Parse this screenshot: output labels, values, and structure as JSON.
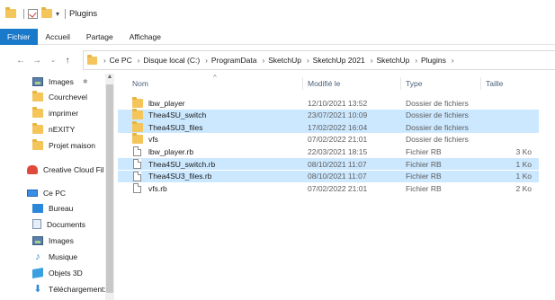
{
  "quick_access": {
    "title": "Plugins"
  },
  "ribbon": {
    "tabs": [
      "Fichier",
      "Accueil",
      "Partage",
      "Affichage"
    ]
  },
  "address": {
    "crumbs": [
      "Ce PC",
      "Disque local (C:)",
      "ProgramData",
      "SketchUp",
      "SketchUp 2021",
      "SketchUp",
      "Plugins"
    ]
  },
  "nav": {
    "items": [
      {
        "label": "Images",
        "icon": "images-icon"
      },
      {
        "label": "Courchevel",
        "icon": "folder-icon"
      },
      {
        "label": "imprimer",
        "icon": "folder-icon"
      },
      {
        "label": "nEXITY",
        "icon": "folder-icon"
      },
      {
        "label": "Projet maison",
        "icon": "folder-icon"
      },
      {
        "label": "Creative Cloud Fil",
        "icon": "creative-cloud-icon"
      },
      {
        "label": "Ce PC",
        "icon": "computer-icon"
      },
      {
        "label": "Bureau",
        "icon": "desktop-icon"
      },
      {
        "label": "Documents",
        "icon": "documents-icon"
      },
      {
        "label": "Images",
        "icon": "images-icon"
      },
      {
        "label": "Musique",
        "icon": "music-icon"
      },
      {
        "label": "Objets 3D",
        "icon": "objects-3d-icon"
      },
      {
        "label": "Téléchargement:",
        "icon": "download-icon"
      }
    ]
  },
  "columns": {
    "name": "Nom",
    "date": "Modifié le",
    "type": "Type",
    "size": "Taille"
  },
  "files": [
    {
      "name": "lbw_player",
      "date": "12/10/2021 13:52",
      "type": "Dossier de fichiers",
      "size": "",
      "kind": "folder",
      "selected": false
    },
    {
      "name": "Thea4SU_switch",
      "date": "23/07/2021 10:09",
      "type": "Dossier de fichiers",
      "size": "",
      "kind": "folder",
      "selected": true
    },
    {
      "name": "Thea4SU3_files",
      "date": "17/02/2022 16:04",
      "type": "Dossier de fichiers",
      "size": "",
      "kind": "folder",
      "selected": true
    },
    {
      "name": "vfs",
      "date": "07/02/2022 21:01",
      "type": "Dossier de fichiers",
      "size": "",
      "kind": "folder",
      "selected": false
    },
    {
      "name": "lbw_player.rb",
      "date": "22/03/2021 18:15",
      "type": "Fichier RB",
      "size": "3 Ko",
      "kind": "file",
      "selected": false
    },
    {
      "name": "Thea4SU_switch.rb",
      "date": "08/10/2021 11:07",
      "type": "Fichier RB",
      "size": "1 Ko",
      "kind": "file",
      "selected": true
    },
    {
      "name": "Thea4SU3_files.rb",
      "date": "08/10/2021 11:07",
      "type": "Fichier RB",
      "size": "1 Ko",
      "kind": "file",
      "selected": true
    },
    {
      "name": "vfs.rb",
      "date": "07/02/2022 21:01",
      "type": "Fichier RB",
      "size": "2 Ko",
      "kind": "file",
      "selected": false
    }
  ],
  "colors": {
    "accent": "#1979ca",
    "selection": "#cce8ff",
    "folder": "#f4c55a"
  }
}
